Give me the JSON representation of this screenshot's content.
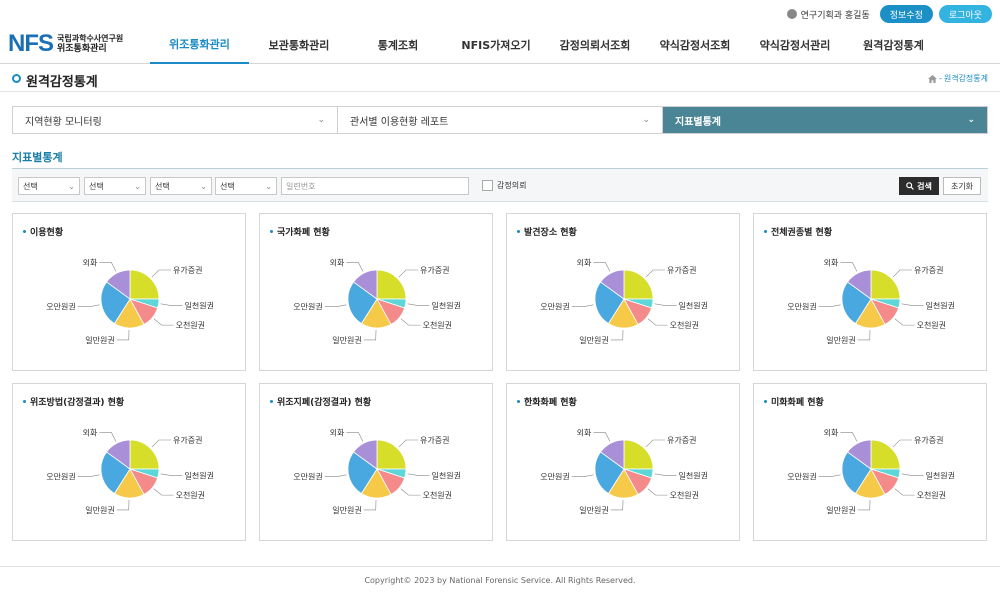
{
  "utility": {
    "user": "연구기획과 홍길동",
    "edit_label": "정보수정",
    "logout_label": "로그아웃"
  },
  "logo": {
    "mark": "NFS",
    "line1": "국립과학수사연구원",
    "line2": "위조통화관리"
  },
  "nav": [
    {
      "label": "위조통화관리",
      "active": true
    },
    {
      "label": "보관통화관리",
      "active": false
    },
    {
      "label": "통계조회",
      "active": false
    },
    {
      "label": "NFIS가져오기",
      "active": false
    },
    {
      "label": "감정의뢰서조회",
      "active": false
    },
    {
      "label": "약식감정서조회",
      "active": false
    },
    {
      "label": "약식감정서관리",
      "active": false
    },
    {
      "label": "원격감정통계",
      "active": false
    }
  ],
  "page": {
    "title": "원격감정통계",
    "breadcrumb_sep": "-",
    "breadcrumb": "원격감정통계"
  },
  "tabs": [
    {
      "label": "지역현황 모니터링",
      "active": false
    },
    {
      "label": "관서별 이용현황 레포트",
      "active": false
    },
    {
      "label": "지표별통계",
      "active": true
    }
  ],
  "section_title": "지표별통계",
  "filter": {
    "selects": [
      "선택",
      "선택",
      "선택",
      "선택"
    ],
    "serial_placeholder": "일련번호",
    "checkbox_label": "감정의뢰",
    "search_label": "검색",
    "reset_label": "초기화"
  },
  "slice_colors": [
    "#d6de2a",
    "#5cd6d6",
    "#f48a8a",
    "#f7c948",
    "#4aa8e0",
    "#a98ed8"
  ],
  "cards": [
    {
      "title": "이용현황"
    },
    {
      "title": "국가화폐 현황"
    },
    {
      "title": "발견장소 현황"
    },
    {
      "title": "전체권종별 현황"
    },
    {
      "title": "위조방법(감정결과) 현황"
    },
    {
      "title": "위조지폐(감정결과) 현황"
    },
    {
      "title": "한화화폐 현황"
    },
    {
      "title": "미화화폐 현황"
    }
  ],
  "chart_data": {
    "type": "pie",
    "categories": [
      "유가증권",
      "일천원권",
      "오천원권",
      "일만원권",
      "오만원권",
      "외화"
    ],
    "values": [
      25,
      5,
      12,
      17,
      26,
      15
    ]
  },
  "footer": "Copyright© 2023 by National Forensic Service. All Rights Reserved."
}
